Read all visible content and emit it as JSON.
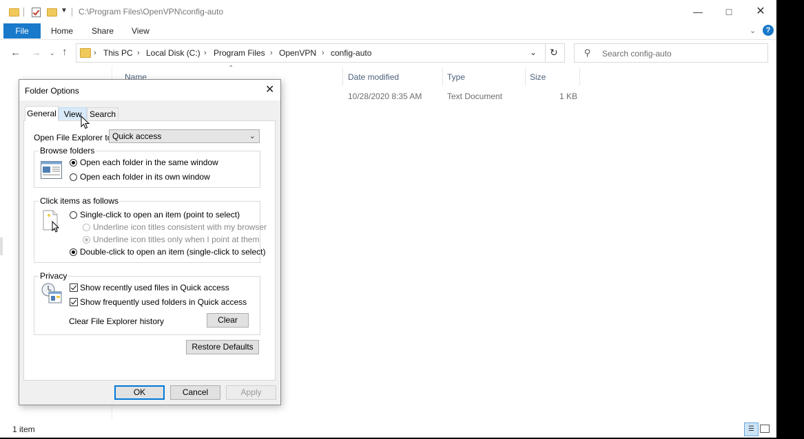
{
  "window": {
    "path": "C:\\Program Files\\OpenVPN\\config-auto"
  },
  "ribbon": {
    "tabs": [
      "File",
      "Home",
      "Share",
      "View"
    ],
    "help": "?"
  },
  "address": {
    "crumbs": [
      "This PC",
      "Local Disk (C:)",
      "Program Files",
      "OpenVPN",
      "config-auto"
    ]
  },
  "search": {
    "placeholder": "Search config-auto"
  },
  "columns": [
    "Name",
    "Date modified",
    "Type",
    "Size"
  ],
  "files": [
    {
      "name": "",
      "date": "10/28/2020 8:35 AM",
      "type": "Text Document",
      "size": "1 KB"
    }
  ],
  "status": {
    "count": "1 item"
  },
  "dialog": {
    "title": "Folder Options",
    "tabs": [
      "General",
      "View",
      "Search"
    ],
    "open_label": "Open File Explorer to:",
    "open_value": "Quick access",
    "browse": {
      "legend": "Browse folders",
      "same": "Open each folder in the same window",
      "own": "Open each folder in its own window"
    },
    "click": {
      "legend": "Click items as follows",
      "single": "Single-click to open an item (point to select)",
      "underline_browser": "Underline icon titles consistent with my browser",
      "underline_point": "Underline icon titles only when I point at them",
      "double": "Double-click to open an item (single-click to select)"
    },
    "privacy": {
      "legend": "Privacy",
      "recent": "Show recently used files in Quick access",
      "frequent": "Show frequently used folders in Quick access",
      "clear_label": "Clear File Explorer history",
      "clear_btn": "Clear"
    },
    "restore": "Restore Defaults",
    "ok": "OK",
    "cancel": "Cancel",
    "apply": "Apply"
  }
}
